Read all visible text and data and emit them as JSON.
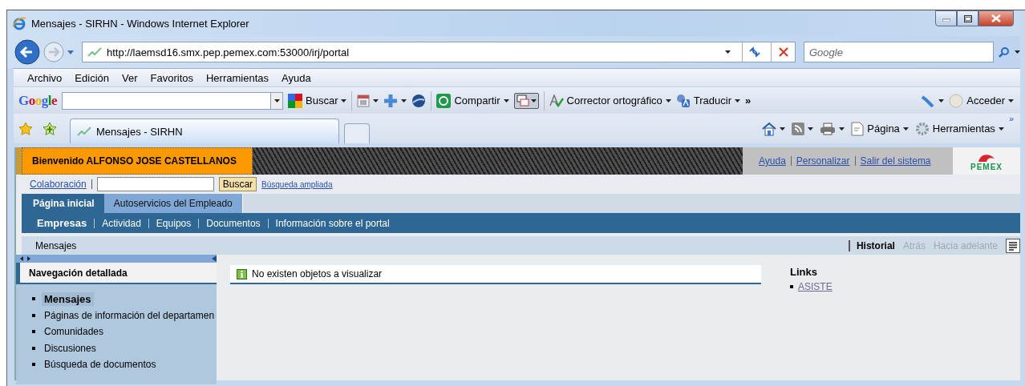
{
  "window": {
    "title": "Mensajes - SIRHN - Windows Internet Explorer"
  },
  "address_bar": {
    "url": "http://laemsd16.smx.pep.pemex.com:53000/irj/portal"
  },
  "search_box": {
    "placeholder": "Google"
  },
  "menu_bar": [
    "Archivo",
    "Edición",
    "Ver",
    "Favoritos",
    "Herramientas",
    "Ayuda"
  ],
  "google_toolbar": {
    "logo": "Google",
    "search_button": "Buscar",
    "share_button": "Compartir",
    "spellcheck_button": "Corrector ortográfico",
    "translate_button": "Traducir",
    "more": "»",
    "sign_in": "Acceder"
  },
  "tabs": [
    {
      "label": "Mensajes - SIRHN",
      "selected": true
    }
  ],
  "command_bar": {
    "page": "Página",
    "tools": "Herramientas",
    "more": "»"
  },
  "portal": {
    "welcome": "Bienvenido ALFONSO JOSE CASTELLANOS",
    "header_links": [
      "Ayuda",
      "Personalizar",
      "Salir del sistema"
    ],
    "logo": "PEMEX",
    "search": {
      "label": "Colaboración",
      "button": "Buscar",
      "advanced": "Búsqueda ampliada"
    },
    "top_tabs": [
      {
        "label": "Página inicial",
        "selected": true
      },
      {
        "label": "Autoservicios del Empleado",
        "selected": false
      }
    ],
    "sub_nav": [
      {
        "label": "Empresas",
        "selected": true
      },
      {
        "label": "Actividad",
        "selected": false
      },
      {
        "label": "Equipos",
        "selected": false
      },
      {
        "label": "Documentos",
        "selected": false
      },
      {
        "label": "Información sobre el portal",
        "selected": false
      }
    ],
    "page_title": "Mensajes",
    "history": [
      {
        "label": "Historial",
        "disabled": false
      },
      {
        "label": "Atrás",
        "disabled": true
      },
      {
        "label": "Hacia adelante",
        "disabled": true
      }
    ],
    "navigation": {
      "title": "Navegación detallada",
      "items": [
        {
          "label": "Mensajes",
          "selected": true
        },
        {
          "label": "Páginas de información del departamen",
          "selected": false
        },
        {
          "label": "Comunidades",
          "selected": false
        },
        {
          "label": "Discusiones",
          "selected": false
        },
        {
          "label": "Búsqueda de documentos",
          "selected": false
        }
      ]
    },
    "message": "No existen objetos a visualizar",
    "links": {
      "title": "Links",
      "items": [
        "ASISTE"
      ]
    }
  }
}
